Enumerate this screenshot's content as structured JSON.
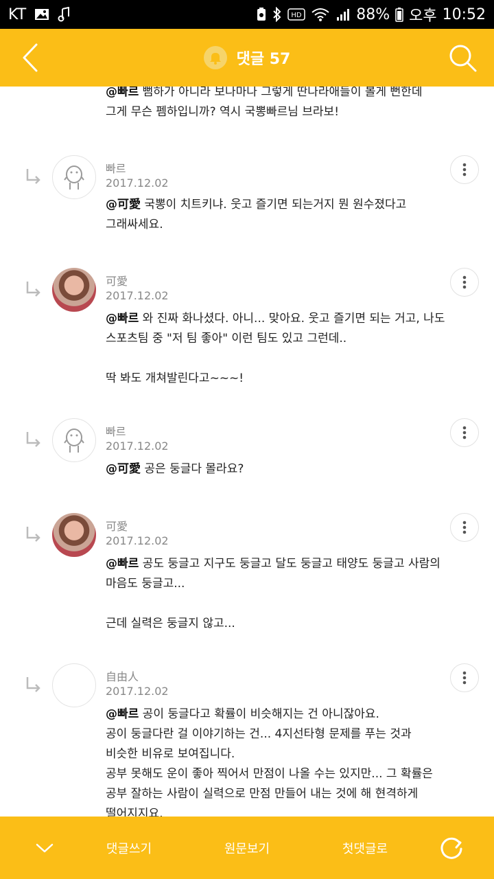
{
  "status_bar": {
    "carrier": "KT",
    "battery": "88%",
    "ampm": "오후",
    "time": "10:52"
  },
  "header": {
    "title": "댓글 57"
  },
  "comments": [
    {
      "body_mention": "@빠르",
      "body_text": " 뻠하가 아니라 보나마나 그렇게 딴나라애들이 볼게 뻔한데\n그게 무슨 펨하입니까? 역시 국뽕빠르님 브라보!"
    },
    {
      "author": "빠르",
      "date": "2017.12.02",
      "body_mention": "@可愛",
      "body_text": " 국뽕이 치트키냐. 웃고 즐기면 되는거지 뭔 원수졌다고\n그래싸세요."
    },
    {
      "author": "可愛",
      "date": "2017.12.02",
      "body_mention": "@빠르",
      "body_text": " 와 진짜 화나셨다. 아니... 맞아요. 웃고 즐기면 되는 거고, 나도\n스포츠팀 중 \"저 팀 좋아\" 이런 팀도 있고 그런데..\n\n딱 봐도 개쳐발린다고~~~!"
    },
    {
      "author": "빠르",
      "date": "2017.12.02",
      "body_mention": "@可愛",
      "body_text": " 공은 둥글다 몰라요?"
    },
    {
      "author": "可愛",
      "date": "2017.12.02",
      "body_mention": "@빠르",
      "body_text": " 공도 둥글고 지구도 둥글고 달도 둥글고 태양도 둥글고 사람의\n마음도 둥글고...\n\n근데 실력은 둥글지 않고..."
    },
    {
      "author": "自由人",
      "date": "2017.12.02",
      "body_mention": "@빠르",
      "body_text": " 공이 둥글다고 확률이 비슷해지는 건 아니잖아요.\n공이 둥글다란 걸 이야기하는 건... 4지선타형 문제를 푸는 것과\n비슷한 비유로 보여집니다.\n공부 못해도 운이 좋아 찍어서 만점이 나올 수는 있지만... 그 확률은\n공부 잘하는 사람이 실력으로 만점 만들어 내는 것에 해 현격하게\n떨어지지요."
    }
  ],
  "bottom_bar": {
    "write_label": "댓글쓰기",
    "original_label": "원문보기",
    "first_label": "첫댓글로"
  },
  "colors": {
    "accent": "#FBBE17"
  }
}
